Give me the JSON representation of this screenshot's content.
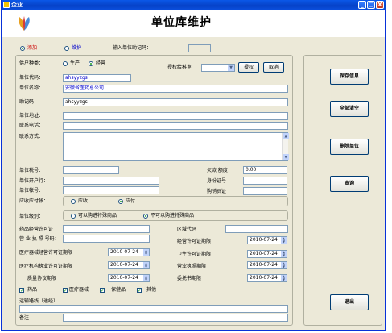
{
  "window": {
    "title": "企业",
    "minimize": "_",
    "maximize": "□",
    "close": "X"
  },
  "header": {
    "title": "单位库维护"
  },
  "top": {
    "add_label": "添加",
    "maintain_label": "维护",
    "help_code_label": "输入单位助记码：",
    "help_code_value": ""
  },
  "form": {
    "supplier_type_label": "供户种类：",
    "producer_label": "生产",
    "operator_label": "经营",
    "auth_type_label": "授权给科室",
    "auth_button": "授权",
    "cancel_button": "取消",
    "unit_code_label": "单位代码：",
    "unit_code_value": "ahsyyzgs",
    "unit_name_label": "单位名称：",
    "unit_name_value": "安徽省医药总公司",
    "help_code_label": "助记码：",
    "help_code_value": "ahsyyzgs",
    "address_label": "单位地址：",
    "address_value": "",
    "phone_label": "联系电话：",
    "phone_value": "",
    "contact_label": "联系方式：",
    "contact_value": "",
    "tax_no_label": "单位税号：",
    "arrears_label": "欠款 额度：",
    "arrears_value": "0.00",
    "bank_label": "单位开户行：",
    "id_label": "身份证号",
    "account_label": "单位帐号：",
    "buyer_id_label": "购销员证",
    "receivable_label": "应收应付帐：",
    "receivable_opt": "应收",
    "payable_opt": "应付",
    "level_label": "单位级别：",
    "level_opt1": "可以购进特殊商品",
    "level_opt2": "不可以购进特殊商品",
    "drug_license_label": "药品经营许可证",
    "region_label": "区域代码",
    "business_license_label": "营 业 执 照 号码：",
    "operating_expiry_label": "经营许可证期限",
    "operating_expiry_value": "2010-07-24",
    "device_expiry_label": "医疗器械经营许可证期限",
    "device_expiry_value": "2010-07-24",
    "health_expiry_label": "卫生许可证期限",
    "health_expiry_value": "2010-07-24",
    "inst_expiry_label": "医疗机构执业许可证期限",
    "inst_expiry_value": "2010-07-24",
    "biz_expiry_label": "营业执照期限",
    "biz_expiry_value": "2010-07-24",
    "quality_expiry_label": "质量协议期限",
    "quality_expiry_value": "2010-07-24",
    "proxy_expiry_label": "委托书期限",
    "proxy_expiry_value": "2010-07-24",
    "cb_drug": "药品",
    "cb_device": "医疗器械",
    "cb_health": "保健品",
    "cb_other": "其他",
    "route_label": "运输路线（途经）",
    "note_label": "备注"
  },
  "side": {
    "save": "保存信息",
    "clear": "全部清空",
    "delete": "删除单位",
    "query": "查询",
    "exit": "退出"
  }
}
